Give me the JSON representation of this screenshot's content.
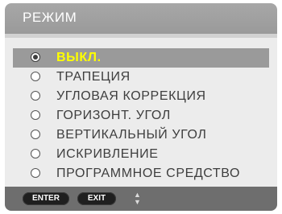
{
  "menu": {
    "title": "РЕЖИМ",
    "options": [
      {
        "label": "ВЫКЛ.",
        "selected": true
      },
      {
        "label": "ТРАПЕЦИЯ",
        "selected": false
      },
      {
        "label": "УГЛОВАЯ КОРРЕКЦИЯ",
        "selected": false
      },
      {
        "label": "ГОРИЗОНТ. УГОЛ",
        "selected": false
      },
      {
        "label": "ВЕРТИКАЛЬНЫЙ УГОЛ",
        "selected": false
      },
      {
        "label": "ИСКРИВЛЕНИЕ",
        "selected": false
      },
      {
        "label": "ПРОГРАММНОЕ СРЕДСТВО",
        "selected": false
      }
    ]
  },
  "footer": {
    "enter_label": "ENTER",
    "exit_label": "EXIT",
    "updown_icon": "up-down-arrows"
  },
  "colors": {
    "title_bar": "#9e9e9e",
    "highlight_bg": "#9a9a9a",
    "highlight_text": "#ffff00",
    "footer_bg": "#6e6e6e"
  }
}
